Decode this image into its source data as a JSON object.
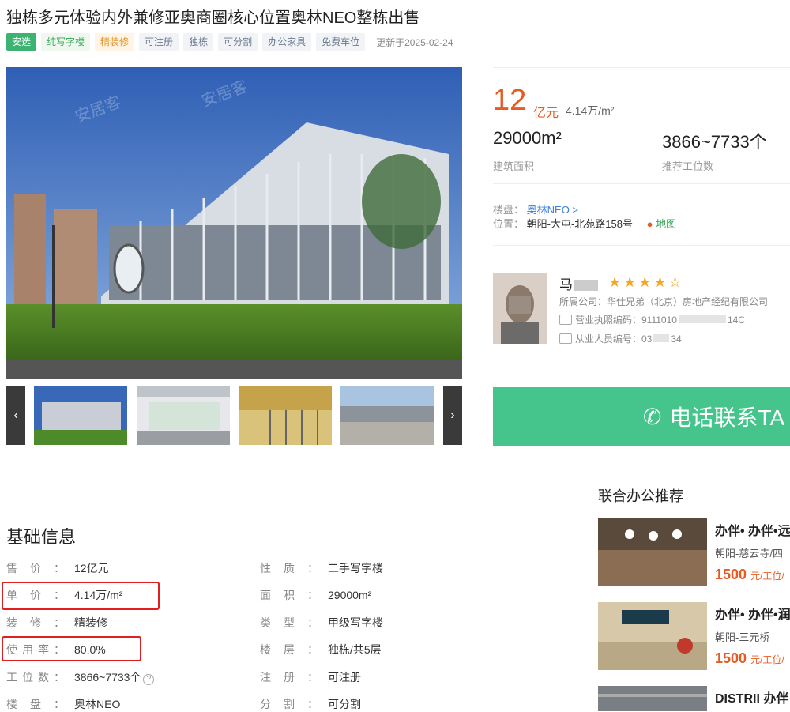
{
  "title": "独栋多元体验内外兼修亚奥商圈核心位置奥林NEO整栋出售",
  "tags": [
    {
      "label": "安选",
      "style": "green"
    },
    {
      "label": "纯写字楼",
      "style": "lgreen"
    },
    {
      "label": "精装修",
      "style": "orange"
    },
    {
      "label": "可注册",
      "style": "gray"
    },
    {
      "label": "独栋",
      "style": "gray"
    },
    {
      "label": "可分割",
      "style": "gray"
    },
    {
      "label": "办公家具",
      "style": "gray"
    },
    {
      "label": "免费车位",
      "style": "gray"
    }
  ],
  "updated": "更新于2025-02-24",
  "price": {
    "value": "12",
    "unit": "亿元",
    "per_unit": "4.14万/m²"
  },
  "stats": [
    {
      "value": "29000m²",
      "label": "建筑面积"
    },
    {
      "value": "3866~7733个",
      "label": "推荐工位数"
    }
  ],
  "property": {
    "label": "楼盘：",
    "name": "奥林NEO >"
  },
  "location": {
    "label": "位置：",
    "value": "朝阳-大屯-北苑路158号",
    "map": "地图"
  },
  "agent": {
    "name": "马",
    "stars": "★★★★☆",
    "company": "所属公司：华仕兄弟（北京）房地产经纪有限公司",
    "license": "营业执照编码：9111010",
    "license_tail": "14C",
    "cert": "从业人员编号：03",
    "cert_tail": "34"
  },
  "call_button": "电话联系TA",
  "basic_info": {
    "title": "基础信息",
    "left": [
      {
        "label": "售价：",
        "value": "12亿元"
      },
      {
        "label": "单价：",
        "value": "4.14万/m²"
      },
      {
        "label": "装修：",
        "value": "精装修"
      },
      {
        "label": "使用率：",
        "value": "80.0%"
      },
      {
        "label": "工位数：",
        "value": "3866~7733个"
      },
      {
        "label": "楼盘：",
        "value": "奥林NEO"
      }
    ],
    "right": [
      {
        "label": "性质：",
        "value": "二手写字楼"
      },
      {
        "label": "面积：",
        "value": "29000m²"
      },
      {
        "label": "类型：",
        "value": "甲级写字楼"
      },
      {
        "label": "楼层：",
        "value": "独栋/共5层"
      },
      {
        "label": "注册：",
        "value": "可注册"
      },
      {
        "label": "分割：",
        "value": "可分割"
      }
    ]
  },
  "recommend": {
    "title": "联合办公推荐",
    "items": [
      {
        "name": "办伴• 办伴•远",
        "loc": "朝阳-慈云寺/四",
        "price": "1500",
        "unit": "元/工位/"
      },
      {
        "name": "办伴• 办伴•润",
        "loc": "朝阳-三元桥",
        "price": "1500",
        "unit": "元/工位/"
      },
      {
        "name": "DISTRII 办伴"
      }
    ]
  }
}
